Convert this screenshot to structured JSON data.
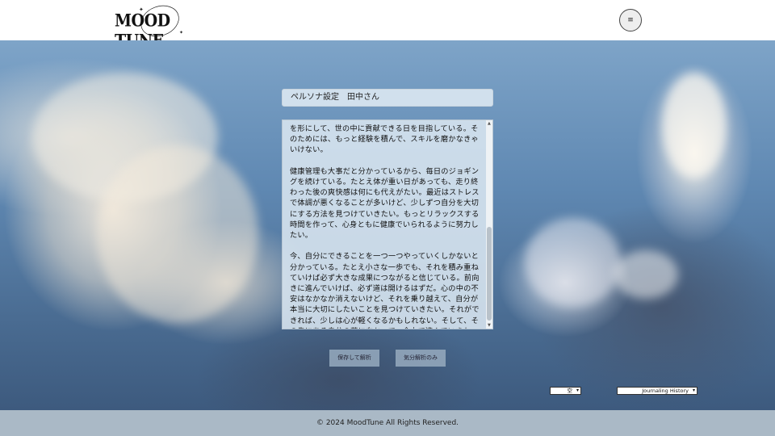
{
  "header": {
    "logo_text": "MOOD TUNE",
    "menu_icon": "≡"
  },
  "persona": {
    "title": "ペルソナ設定　田中さん"
  },
  "journal": {
    "paragraphs": [
      "を形にして、世の中に貢献できる日を目指している。そのためには、もっと経験を積んで、スキルを磨かなきゃいけない。",
      "健康管理も大事だと分かっているから、毎日のジョギングを続けている。たとえ体が重い日があっても、走り終わった後の爽快感は何にも代えがたい。最近はストレスで体調が悪くなることが多いけど、少しずつ自分を大切にする方法を見つけていきたい。もっとリラックスする時間を作って、心身ともに健康でいられるように努力したい。",
      "今、自分にできることを一つ一つやっていくしかないと分かっている。たとえ小さな一歩でも、それを積み重ねていけば必ず大きな成果につながると信じている。前向きに進んでいけば、必ず道は開けるはずだ。心の中の不安はなかなか消えないけど、それを乗り越えて、自分が本当に大切にしたいことを見つけていきたい。それができれば、少しは心が軽くなるかもしれない。そして、その先にある自分の夢に向かって、全力で進んでいきたい。"
    ]
  },
  "buttons": {
    "save_label": "保存して解析",
    "mood_label": "気分解析のみ"
  },
  "selects": {
    "weather_value": "空",
    "history_value": "Journaling History"
  },
  "footer": {
    "copyright": "© 2024 MoodTune All Rights Reserved."
  }
}
